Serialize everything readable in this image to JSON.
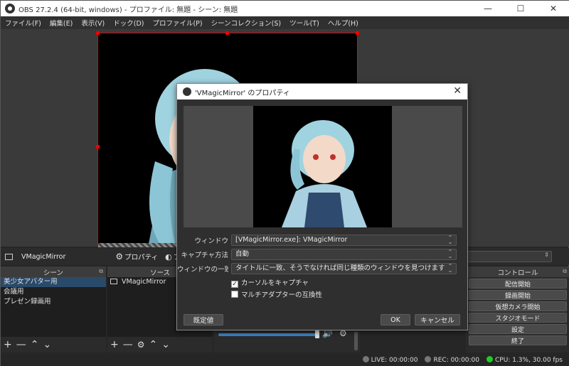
{
  "window": {
    "title": "OBS 27.2.4 (64-bit, windows) - プロファイル: 無題 - シーン: 無題"
  },
  "menu": [
    "ファイル(F)",
    "編集(E)",
    "表示(V)",
    "ドック(D)",
    "プロファイル(P)",
    "シーンコレクション(S)",
    "ツール(T)",
    "ヘルプ(H)"
  ],
  "source_toolbar": {
    "selected_source": "VMagicMirror",
    "properties_label": "プロパティ",
    "filters_label": "フィ"
  },
  "scenes": {
    "header": "シーン",
    "items": [
      "美少女アバター用",
      "会議用",
      "プレゼン録画用"
    ]
  },
  "sources": {
    "header": "ソース",
    "items": [
      "VMagicMirror"
    ]
  },
  "controls": {
    "header": "コントロール",
    "buttons": [
      "配信開始",
      "録画開始",
      "仮想カメラ開始",
      "スタジオモード",
      "設定",
      "終了"
    ]
  },
  "status": {
    "live": "LIVE: 00:00:00",
    "rec": "REC: 00:00:00",
    "cpu": "CPU: 1.3%, 30.00 fps"
  },
  "dialog": {
    "title": "'VMagicMirror' のプロパティ",
    "fields": [
      {
        "label": "ウィンドウ",
        "value": "[VMagicMirror.exe]: VMagicMirror"
      },
      {
        "label": "キャプチャ方法",
        "value": "自動"
      },
      {
        "label": "ウィンドウの一致",
        "value": "タイトルに一致、そうでなければ同じ種類のウィンドウを見つけます"
      }
    ],
    "checkboxes": [
      {
        "label": "カーソルをキャプチャ",
        "checked": true
      },
      {
        "label": "マルチアダプターの互換性",
        "checked": false
      }
    ],
    "defaults_label": "既定値",
    "ok_label": "OK",
    "cancel_label": "キャンセル"
  },
  "colors": {
    "selection_border": "#ee0000",
    "accent": "#2a4a6a"
  }
}
